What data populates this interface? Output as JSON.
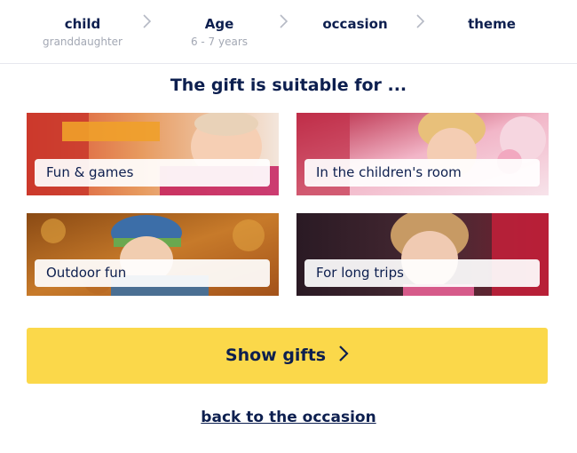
{
  "steps": [
    {
      "label": "child",
      "sub": "granddaughter"
    },
    {
      "label": "Age",
      "sub": "6 - 7 years"
    },
    {
      "label": "occasion",
      "sub": ""
    },
    {
      "label": "theme",
      "sub": ""
    }
  ],
  "main": {
    "title": "The gift is suitable for ...",
    "cards": [
      {
        "label": "Fun & games",
        "image": "baby-playing-photo"
      },
      {
        "label": "In the children's room",
        "image": "girl-with-toys-photo"
      },
      {
        "label": "Outdoor fun",
        "image": "baby-in-autumn-leaves-photo"
      },
      {
        "label": "For long trips",
        "image": "girl-in-car-seat-photo"
      }
    ]
  },
  "actions": {
    "show_gifts": "Show gifts",
    "back": "back to the occasion"
  },
  "colors": {
    "primary_text": "#0d1f4f",
    "button": "#fbd84a",
    "muted": "#a3a8b4"
  }
}
